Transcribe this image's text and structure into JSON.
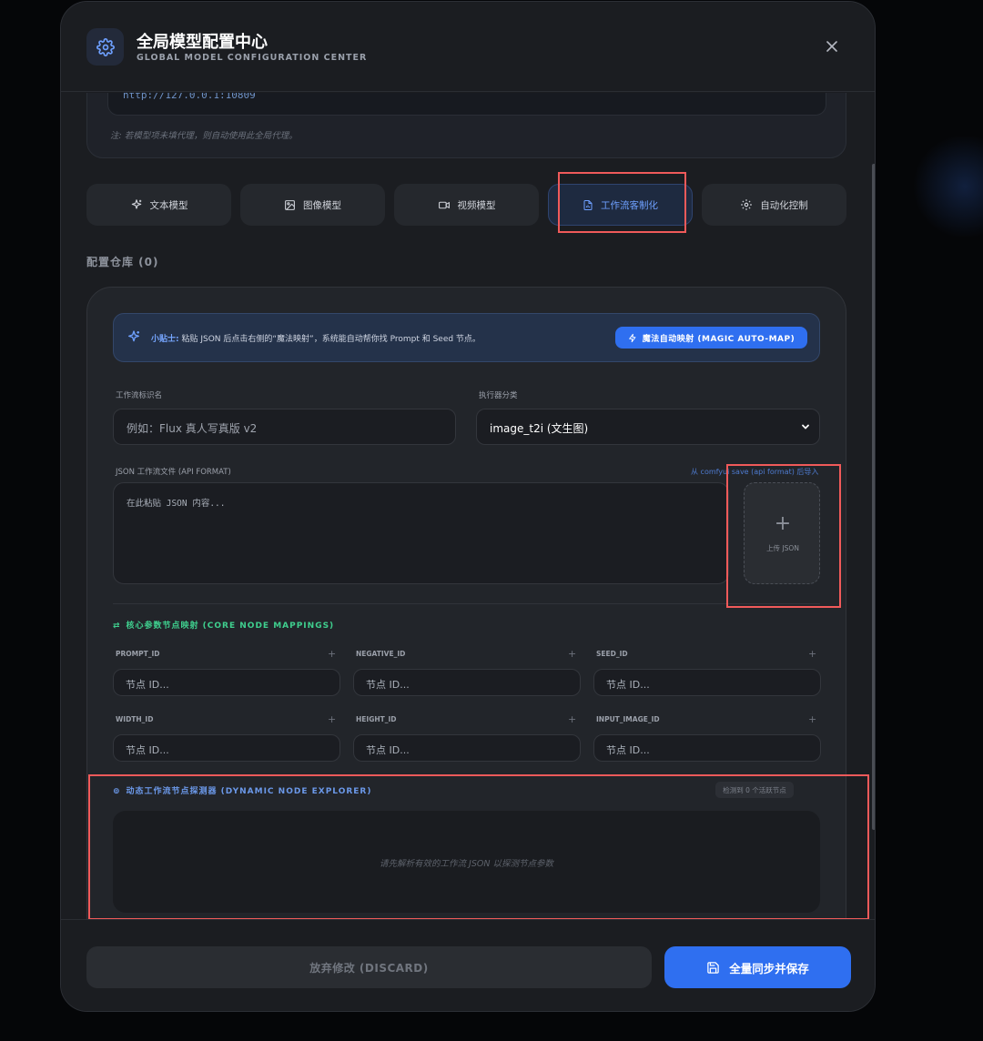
{
  "header": {
    "title": "全局模型配置中心",
    "subtitle": "GLOBAL MODEL CONFIGURATION CENTER"
  },
  "proxy": {
    "value": "http://127.0.0.1:10809",
    "note": "注: 若模型项未填代理，则自动使用此全局代理。"
  },
  "tabs": [
    {
      "label": "文本模型",
      "icon": "sparkles-icon"
    },
    {
      "label": "图像模型",
      "icon": "image-icon"
    },
    {
      "label": "视频模型",
      "icon": "video-icon"
    },
    {
      "label": "工作流客制化",
      "icon": "file-chart-icon",
      "active": true
    },
    {
      "label": "自动化控制",
      "icon": "gear-icon"
    }
  ],
  "repo": {
    "title": "配置仓库 (0)"
  },
  "tip": {
    "label": "小贴士:",
    "text": " 粘贴 JSON 后点击右侧的“魔法映射”，系统能自动帮你找 Prompt 和 Seed 节点。",
    "button": "魔法自动映射 (MAGIC AUTO-MAP)"
  },
  "form": {
    "name_label": "工作流标识名",
    "name_placeholder": "例如：Flux 真人写真版 v2",
    "exec_label": "执行器分类",
    "exec_value": "image_t2i (文生图)",
    "json_label": "JSON 工作流文件 (API FORMAT)",
    "json_hint": "从 comfyui save (api format) 后导入",
    "json_placeholder": "在此粘贴 JSON 内容...",
    "upload_label": "上传 JSON"
  },
  "mappings": {
    "title": "核心参数节点映射 (CORE NODE MAPPINGS)",
    "items": [
      {
        "label": "PROMPT_ID",
        "placeholder": "节点 ID..."
      },
      {
        "label": "NEGATIVE_ID",
        "placeholder": "节点 ID..."
      },
      {
        "label": "SEED_ID",
        "placeholder": "节点 ID..."
      },
      {
        "label": "WIDTH_ID",
        "placeholder": "节点 ID..."
      },
      {
        "label": "HEIGHT_ID",
        "placeholder": "节点 ID..."
      },
      {
        "label": "INPUT_IMAGE_ID",
        "placeholder": "节点 ID..."
      }
    ]
  },
  "explorer": {
    "title": "动态工作流节点探测器 (DYNAMIC NODE EXPLORER)",
    "badge": "检测到 0 个活跃节点",
    "empty": "请先解析有效的工作流 JSON 以探测节点参数"
  },
  "footer": {
    "discard": "放弃修改 (DISCARD)",
    "save": "全量同步并保存"
  },
  "colors": {
    "accent": "#2f6ff0",
    "highlight": "#f05a5a",
    "success": "#3fcf8e"
  }
}
